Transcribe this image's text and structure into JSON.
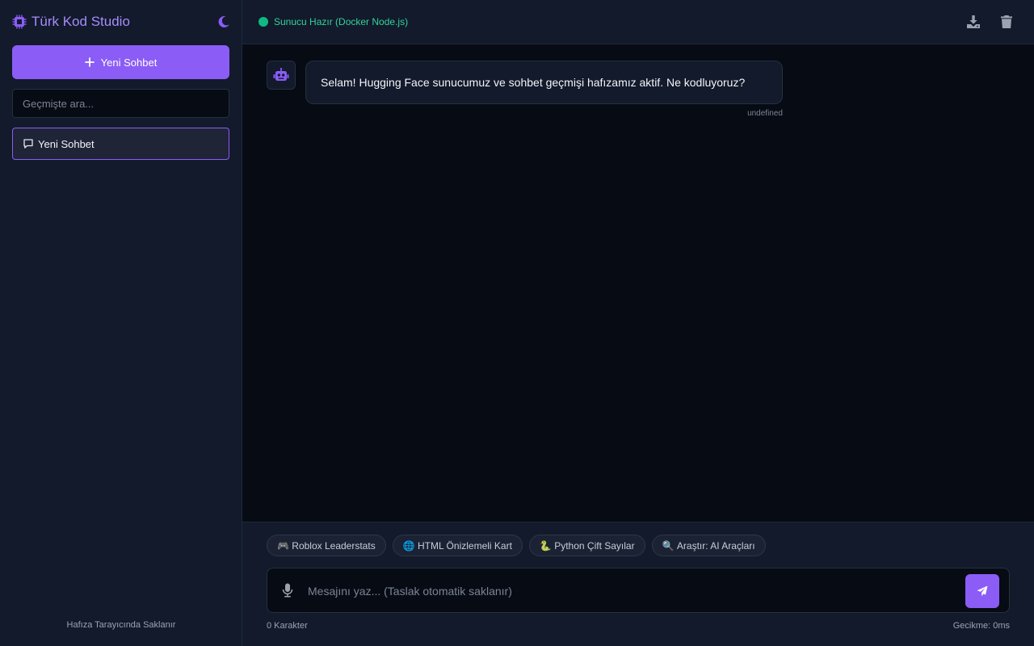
{
  "app": {
    "title": "Türk Kod Studio",
    "accent_color": "#8b5cf6"
  },
  "icons": {
    "brand": "microchip-icon",
    "theme_toggle": "moon-icon",
    "new_chat": "plus-icon",
    "chat_item": "comment-icon",
    "download": "download-icon",
    "delete": "trash-icon",
    "bot": "robot-icon",
    "mic": "microphone-icon",
    "send": "paper-plane-icon"
  },
  "sidebar": {
    "new_chat_label": "Yeni Sohbet",
    "search_placeholder": "Geçmişte ara...",
    "history": [
      {
        "label": "Yeni Sohbet",
        "active": true
      }
    ],
    "footer": "Hafıza Tarayıcında Saklanır"
  },
  "header": {
    "status_text": "Sunucu Hazır (Docker Node.js)",
    "status_color": "#10b981"
  },
  "messages": [
    {
      "role": "bot",
      "text": "Selam! Hugging Face sunucumuz ve sohbet geçmişi hafızamız aktif. Ne kodluyoruz?",
      "time": "undefined"
    }
  ],
  "suggestions": [
    {
      "emoji": "🎮",
      "label": "Roblox Leaderstats"
    },
    {
      "emoji": "🌐",
      "label": "HTML Önizlemeli Kart"
    },
    {
      "emoji": "🐍",
      "label": "Python Çift Sayılar"
    },
    {
      "emoji": "🔍",
      "label": "Araştır: AI Araçları"
    }
  ],
  "composer": {
    "placeholder": "Mesajını yaz... (Taslak otomatik saklanır)",
    "value": "",
    "char_count": "0 Karakter",
    "latency": "Gecikme: 0ms"
  }
}
